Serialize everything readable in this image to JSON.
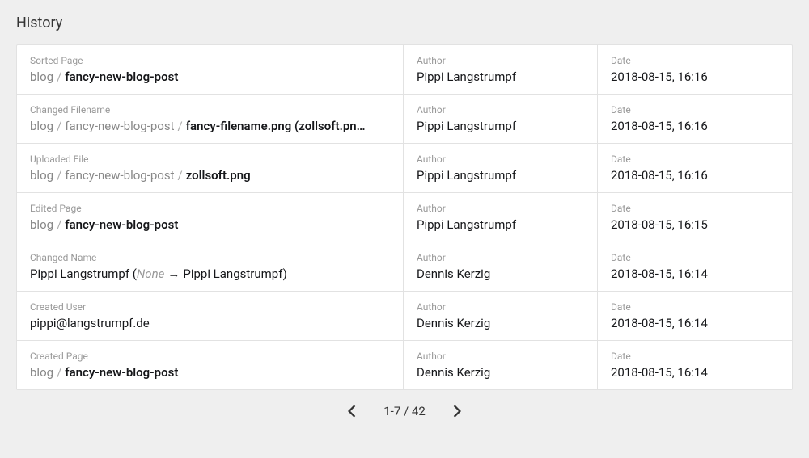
{
  "title": "History",
  "columns": {
    "author": "Author",
    "date": "Date"
  },
  "rows": [
    {
      "action": "Sorted Page",
      "desc_html": "<span class='light'>blog</span><span class='sep'>/</span><span class='bold'>fancy-new-blog-post</span>",
      "author": "Pippi Langstrumpf",
      "date": "2018-08-15, 16:16"
    },
    {
      "action": "Changed Filename",
      "desc_html": "<span class='light'>blog</span><span class='sep'>/</span><span class='light'>fancy-new-blog-post</span><span class='sep'>/</span><span class='bold'>fancy-filename.png (zollsoft.pn…</span>",
      "author": "Pippi Langstrumpf",
      "date": "2018-08-15, 16:16"
    },
    {
      "action": "Uploaded File",
      "desc_html": "<span class='light'>blog</span><span class='sep'>/</span><span class='light'>fancy-new-blog-post</span><span class='sep'>/</span><span class='bold'>zollsoft.png</span>",
      "author": "Pippi Langstrumpf",
      "date": "2018-08-15, 16:16"
    },
    {
      "action": "Edited Page",
      "desc_html": "<span class='light'>blog</span><span class='sep'>/</span><span class='bold'>fancy-new-blog-post</span>",
      "author": "Pippi Langstrumpf",
      "date": "2018-08-15, 16:15"
    },
    {
      "action": "Changed Name",
      "desc_html": "Pippi Langstrumpf (<span class='italic'>None</span><span class='arrow'>→</span>Pippi Langstrumpf)",
      "author": "Dennis Kerzig",
      "date": "2018-08-15, 16:14"
    },
    {
      "action": "Created User",
      "desc_html": "pippi@langstrumpf.de",
      "author": "Dennis Kerzig",
      "date": "2018-08-15, 16:14"
    },
    {
      "action": "Created Page",
      "desc_html": "<span class='light'>blog</span><span class='sep'>/</span><span class='bold'>fancy-new-blog-post</span>",
      "author": "Dennis Kerzig",
      "date": "2018-08-15, 16:14"
    }
  ],
  "pagination": {
    "text": "1-7 / 42"
  }
}
